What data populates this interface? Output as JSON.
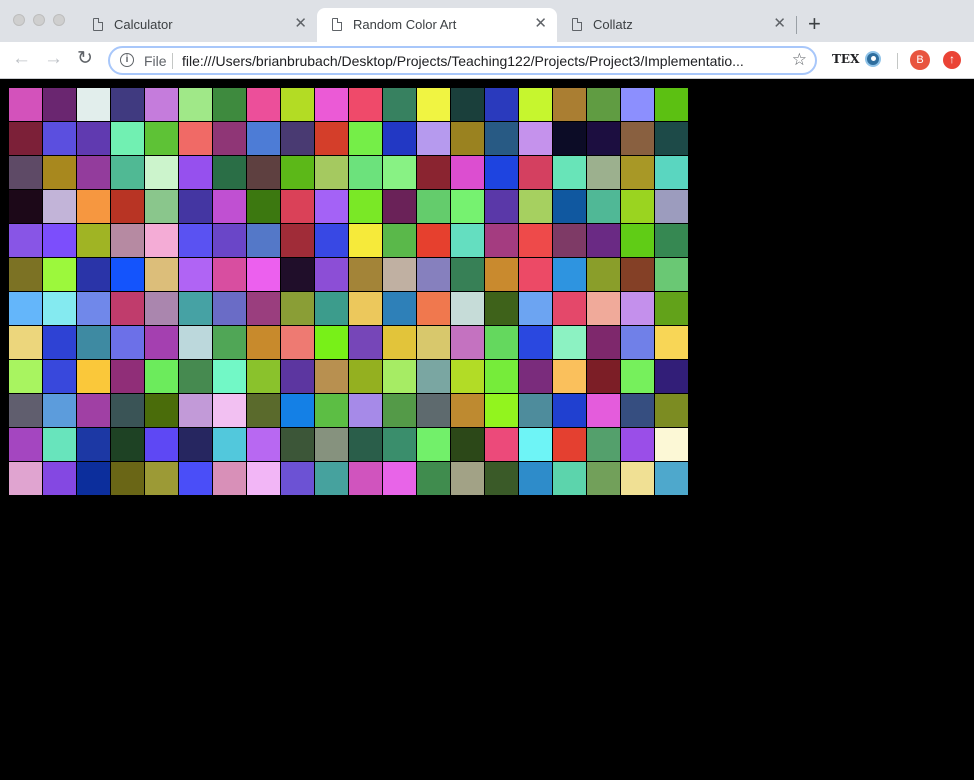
{
  "browser": {
    "tabs": [
      {
        "title": "Calculator",
        "active": false
      },
      {
        "title": "Random Color Art",
        "active": true
      },
      {
        "title": "Collatz",
        "active": false
      }
    ],
    "close_glyph": "✕",
    "new_tab_glyph": "+",
    "address": {
      "scheme": "File",
      "url": "file:///Users/brianbrubach/Desktop/Projects/Teaching122/Projects/Project3/Implementatio..."
    },
    "extensions": {
      "tex_label": "TEX",
      "avatar_initial": "B"
    },
    "icons": [
      "back-icon",
      "forward-icon",
      "reload-icon",
      "info-icon",
      "star-icon",
      "eye-icon",
      "update-icon"
    ]
  },
  "art": {
    "columns": 20,
    "rows": [
      [
        "#d352bb",
        "#6a2670",
        "#e2eeec",
        "#403a80",
        "#c57cdc",
        "#a0e888",
        "#3e8a3e",
        "#ec4f9a",
        "#b3dc24",
        "#eb5ad6",
        "#ef4a6a",
        "#378160",
        "#f0f442",
        "#1a3f3b",
        "#2a3abd",
        "#c6f62e",
        "#aa7e32",
        "#609c42",
        "#8c8ffe",
        "#5cc012"
      ],
      [
        "#7c2038",
        "#5b4fdf",
        "#603ab0",
        "#71f0b2",
        "#5ec236",
        "#f06a66",
        "#8f3676",
        "#4d7cd6",
        "#493a72",
        "#d43e2a",
        "#75ee48",
        "#2238c4",
        "#b69aee",
        "#9a8220",
        "#285a84",
        "#c592ec",
        "#0c0c26",
        "#1c0e40",
        "#896040",
        "#1d4a48"
      ],
      [
        "#5e4a66",
        "#a8881e",
        "#933c9c",
        "#50b994",
        "#ccf4cc",
        "#9650ee",
        "#2a6e46",
        "#5e4040",
        "#5cb818",
        "#a5c960",
        "#6ce27c",
        "#88f284",
        "#8a2430",
        "#dc4ed0",
        "#1e44e0",
        "#d44060",
        "#68e4b8",
        "#9cb08e",
        "#a89826",
        "#5ad6c0"
      ],
      [
        "#1c0818",
        "#c2b4d8",
        "#f69740",
        "#b83424",
        "#8ac68c",
        "#4436a2",
        "#c050d2",
        "#3c7810",
        "#da4158",
        "#a462f6",
        "#7ae826",
        "#6a2258",
        "#64cc6c",
        "#76f270",
        "#5a38a8",
        "#a6d060",
        "#1058a0",
        "#50b896",
        "#9ad420",
        "#9c9cbe"
      ],
      [
        "#8855e6",
        "#7c4efc",
        "#a0b424",
        "#b68aa2",
        "#f4acd6",
        "#5a52f2",
        "#6a46c8",
        "#5478c8",
        "#a02c38",
        "#3848e4",
        "#f6ea3a",
        "#5ab84a",
        "#e6402e",
        "#64dec0",
        "#a43c80",
        "#ee4a4a",
        "#7e3a66",
        "#6a2a84",
        "#60cc16",
        "#368852"
      ],
      [
        "#7c7224",
        "#9cf83c",
        "#2a34a8",
        "#1454fc",
        "#dcbe7a",
        "#b064f4",
        "#d84ea0",
        "#ec60ee",
        "#200e2a",
        "#8c4ed6",
        "#a38438",
        "#c0b0a2",
        "#8680be",
        "#378056",
        "#c98a2e",
        "#ec4a66",
        "#2e94e0",
        "#8a9e2a",
        "#844026",
        "#6ac874"
      ],
      [
        "#64b6fa",
        "#84eaf0",
        "#7088ea",
        "#c03c6c",
        "#aa86ae",
        "#46a2a4",
        "#6a6cc6",
        "#9a3e7e",
        "#8a9e36",
        "#3c9c8c",
        "#ecc85c",
        "#2e80b8",
        "#f0784e",
        "#c6dcd8",
        "#3e621a",
        "#6ca4f2",
        "#e4486a",
        "#f0aa9a",
        "#c490ec",
        "#62a21a"
      ],
      [
        "#ecd67c",
        "#2e42d4",
        "#3e8aa2",
        "#6c70e8",
        "#a440b0",
        "#bcd8dc",
        "#50a656",
        "#c88a2c",
        "#ee7a72",
        "#78f018",
        "#7646b8",
        "#e2c43a",
        "#d8c86c",
        "#c472c0",
        "#64d85e",
        "#2a48e0",
        "#8cf2c2",
        "#7e286c",
        "#7080e8",
        "#f8d656"
      ],
      [
        "#a8f460",
        "#3848dc",
        "#fac83a",
        "#902e78",
        "#6ceb5c",
        "#468a50",
        "#72f8c6",
        "#8ac22c",
        "#5c36a0",
        "#b89050",
        "#94b020",
        "#a6ec64",
        "#7aa6a2",
        "#b2dc26",
        "#76ec3a",
        "#7a2c7c",
        "#fac05c",
        "#7c1e26",
        "#76f05c",
        "#321e78"
      ],
      [
        "#605e6e",
        "#5c9cdc",
        "#a040a4",
        "#3a5456",
        "#4a6c0a",
        "#c29ad8",
        "#f2c0f2",
        "#5a6a2c",
        "#1480e6",
        "#5cbe44",
        "#a68ae8",
        "#549a48",
        "#5e6a6e",
        "#be8a30",
        "#92f41e",
        "#4e8c9c",
        "#2040d0",
        "#e45cdc",
        "#364e80",
        "#7c8c22"
      ],
      [
        "#a446c0",
        "#68e4bc",
        "#1c38a4",
        "#1e4224",
        "#5e48f4",
        "#262660",
        "#52c8dc",
        "#b868f2",
        "#3c5638",
        "#86927e",
        "#2a5e4a",
        "#3a8e6c",
        "#72f06a",
        "#2c4818",
        "#ec4a7a",
        "#6ef4f6",
        "#e44030",
        "#54a06c",
        "#9a4ee8",
        "#fcf8d6"
      ],
      [
        "#e0a4d0",
        "#8448e2",
        "#0c2e9c",
        "#6a6616",
        "#9c9a36",
        "#4a4ef8",
        "#d890b8",
        "#f2b6f6",
        "#6c52d4",
        "#46a29e",
        "#d054be",
        "#e864e8",
        "#408c4e",
        "#a2a286",
        "#3a5a28",
        "#2e8cca",
        "#5cd4ac",
        "#72a05a",
        "#f0e094",
        "#4ea8cc"
      ]
    ]
  }
}
